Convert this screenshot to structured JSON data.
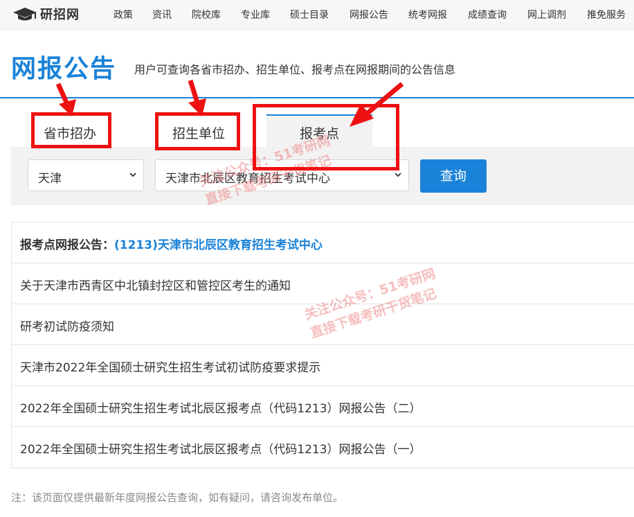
{
  "site": {
    "logo_text": "研招网"
  },
  "nav": [
    "政策",
    "资讯",
    "院校库",
    "专业库",
    "硕士目录",
    "网报公告",
    "统考网报",
    "成绩查询",
    "网上调剂",
    "推免服务"
  ],
  "header": {
    "title": "网报公告",
    "subtitle": "用户可查询各省市招办、招生单位、报考点在网报期间的公告信息"
  },
  "tabs": [
    {
      "label": "省市招办",
      "active": false
    },
    {
      "label": "招生单位",
      "active": false
    },
    {
      "label": "报考点",
      "active": true
    }
  ],
  "filters": {
    "province": "天津",
    "site": "天津市北辰区教育招生考试中心",
    "query_label": "查询"
  },
  "list": {
    "heading_label": "报考点网报公告：",
    "heading_site": "(1213)天津市北辰区教育招生考试中心",
    "items": [
      "关于天津市西青区中北镇封控区和管控区考生的通知",
      "研考初试防疫须知",
      "天津市2022年全国硕士研究生招生考试初试防疫要求提示",
      "2022年全国硕士研究生招生考试北辰区报考点（代码1213）网报公告（二）",
      "2022年全国硕士研究生招生考试北辰区报考点（代码1213）网报公告（一）"
    ]
  },
  "footnote": "注：该页面仅提供最新年度网报公告查询，如有疑问，请咨询发布单位。",
  "watermark": {
    "line1": "关注公众号：51考研网",
    "line2": "直接下载考研干货笔记"
  },
  "colors": {
    "brand_blue": "#1a82d8",
    "annotation_red": "#ee1111"
  }
}
